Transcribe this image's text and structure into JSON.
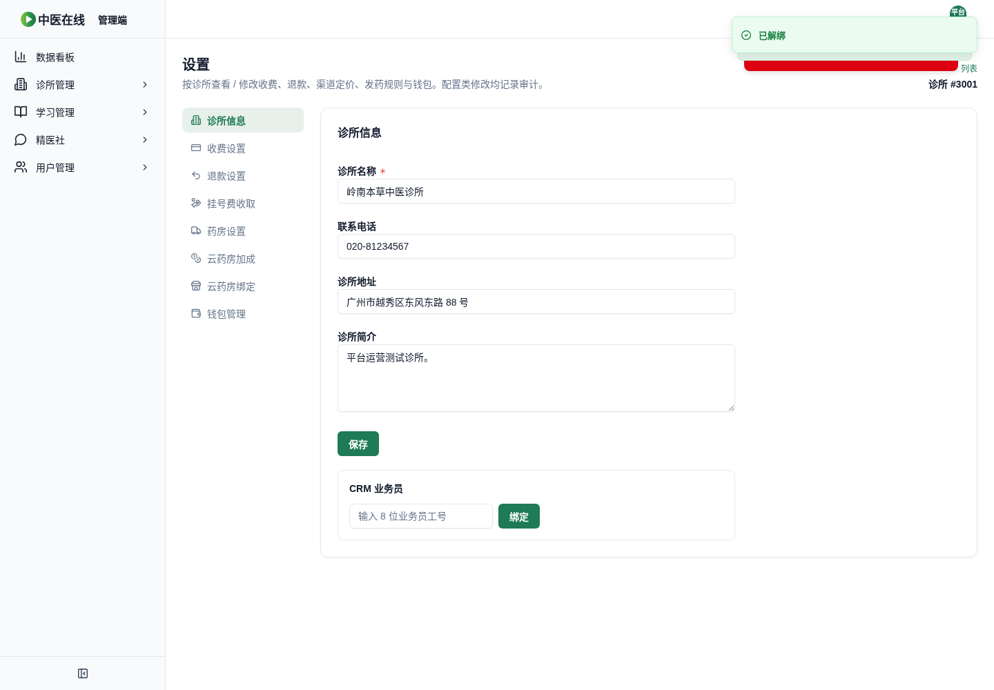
{
  "sidebar": {
    "brand": {
      "name": "中医在线",
      "subtitle": "管理端"
    },
    "items": [
      {
        "label": "数据看板",
        "kind": "link",
        "selected": false
      },
      {
        "label": "诊所管理",
        "kind": "group",
        "selected": false,
        "expanded": false
      },
      {
        "label": "学习管理",
        "kind": "group",
        "selected": false,
        "expanded": false
      },
      {
        "label": "精医社",
        "kind": "group",
        "selected": false,
        "expanded": false
      },
      {
        "label": "用户管理",
        "kind": "group",
        "selected": false,
        "expanded": false
      }
    ]
  },
  "header": {
    "avatar": "平台"
  },
  "toasts": [
    {
      "kind": "success",
      "message": "已解绑"
    },
    {
      "kind": "success"
    },
    {
      "kind": "error"
    }
  ],
  "page": {
    "title": "设置",
    "description": "按诊所查看 / 修改收费、退款、渠道定价、发药规则与钱包。配置类修改均记录审计。",
    "back_link": "列表",
    "clinic": "诊所 #3001"
  },
  "settings_nav": [
    {
      "label": "诊所信息",
      "selected": true
    },
    {
      "label": "收费设置",
      "selected": false
    },
    {
      "label": "退款设置",
      "selected": false
    },
    {
      "label": "挂号费收取",
      "selected": false
    },
    {
      "label": "药房设置",
      "selected": false
    },
    {
      "label": "云药房加成",
      "selected": false
    },
    {
      "label": "云药房绑定",
      "selected": false
    },
    {
      "label": "钱包管理",
      "selected": false
    }
  ],
  "clinic_form": {
    "title": "诊所信息",
    "fields": [
      {
        "kind": "text",
        "label": "诊所名称",
        "required": true,
        "value": "岭南本草中医诊所"
      },
      {
        "kind": "text",
        "label": "联系电话",
        "required": false,
        "value": "020-81234567"
      },
      {
        "kind": "text",
        "label": "诊所地址",
        "required": false,
        "value": "广州市越秀区东风东路 88 号"
      },
      {
        "kind": "textarea",
        "label": "诊所简介",
        "required": false,
        "value": "平台运营测试诊所。"
      }
    ],
    "save_button": "保存",
    "crm": {
      "title": "CRM 业务员",
      "placeholder": "输入 8 位业务员工号",
      "button": "绑定"
    }
  }
}
